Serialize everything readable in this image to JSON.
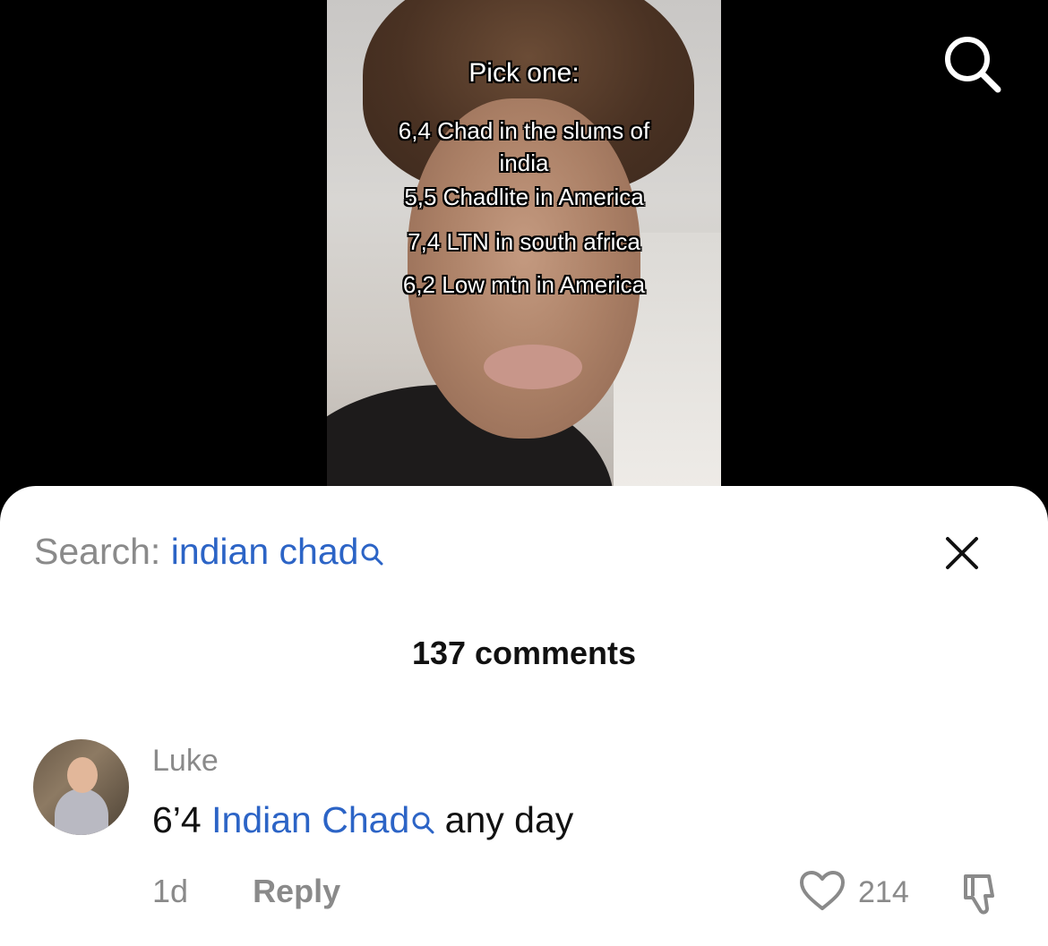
{
  "video": {
    "overlay_title": "Pick one:",
    "overlay_lines": [
      "6,4 Chad in the slums of india",
      "5,5 Chadlite in America",
      "7,4 LTN in south africa",
      "6,2 Low mtn in America"
    ],
    "search_icon": "search-icon"
  },
  "sheet": {
    "search_prefix": "Search:",
    "search_term": "indian chad",
    "close_icon": "close-icon",
    "comments_count_label": "137 comments"
  },
  "comment": {
    "username": "Luke",
    "text_before": "6’4",
    "text_link": "Indian Chad",
    "text_after": "any day",
    "time": "1d",
    "reply_label": "Reply",
    "like_count": "214",
    "like_icon": "heart-outline-icon",
    "dislike_icon": "thumbs-down-icon"
  },
  "colors": {
    "link_blue": "#2c64c6",
    "muted_gray": "#8a8a8a",
    "text_dark": "#111111"
  }
}
